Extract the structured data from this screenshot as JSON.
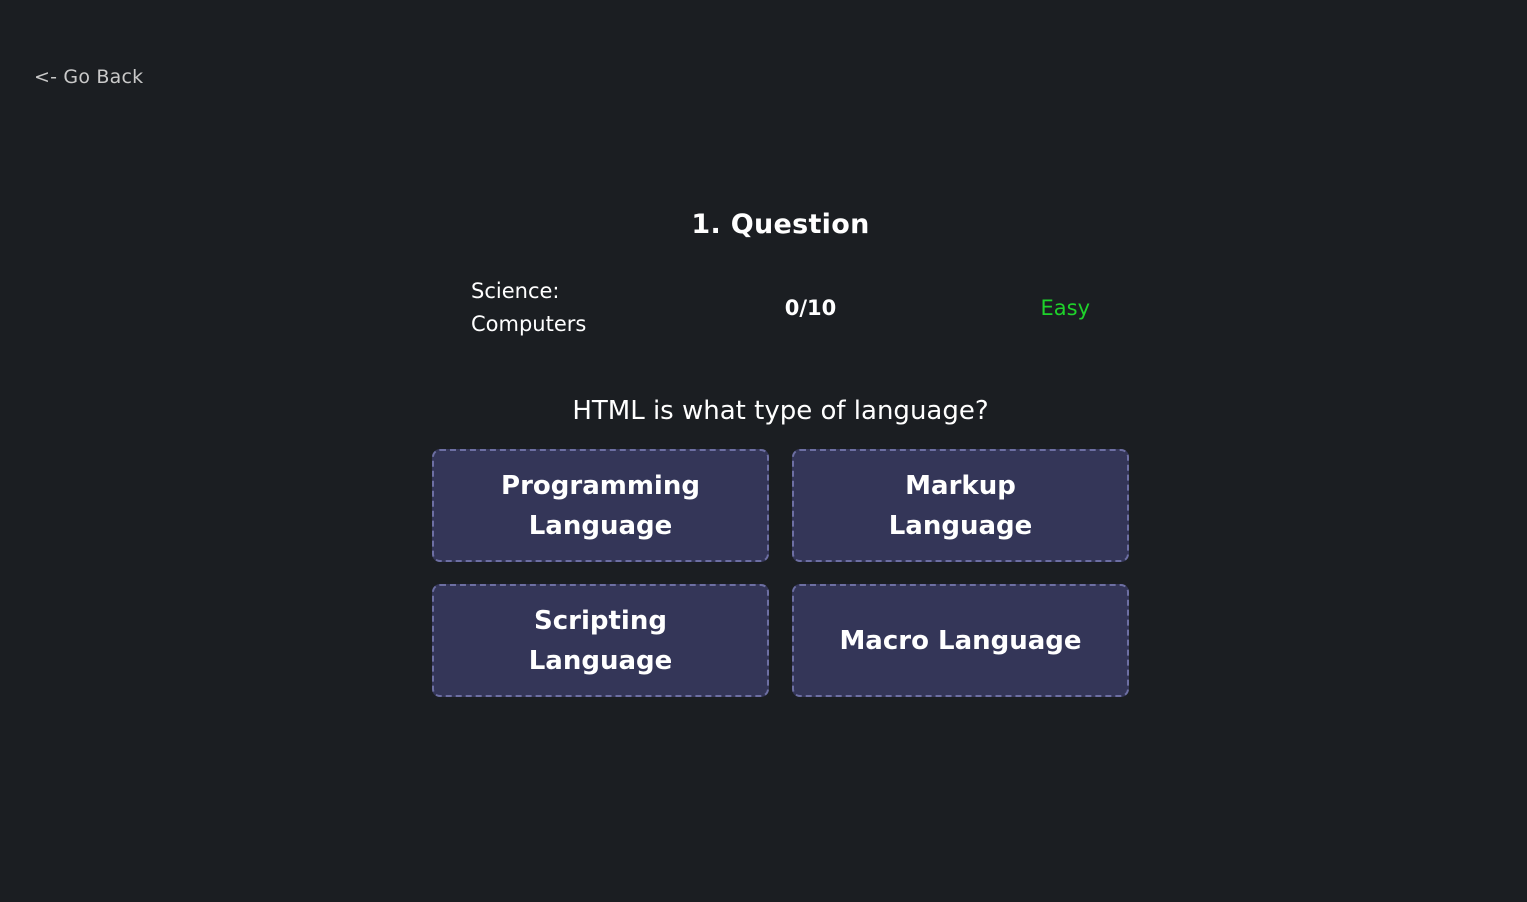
{
  "nav": {
    "back_label": "<- Go Back"
  },
  "quiz": {
    "title": "1. Question",
    "category_line1": "Science:",
    "category_line2": "Computers",
    "score": "0/10",
    "difficulty": "Easy",
    "question": "HTML is what type of language?",
    "answers": [
      {
        "label": "Programming Language"
      },
      {
        "label": "Markup Language"
      },
      {
        "label": "Scripting Language"
      },
      {
        "label": "Macro Language"
      }
    ]
  },
  "colors": {
    "background": "#1b1e22",
    "answer_bg": "#343658",
    "answer_border": "#6d6fa3",
    "difficulty_easy": "#1ed32a"
  }
}
